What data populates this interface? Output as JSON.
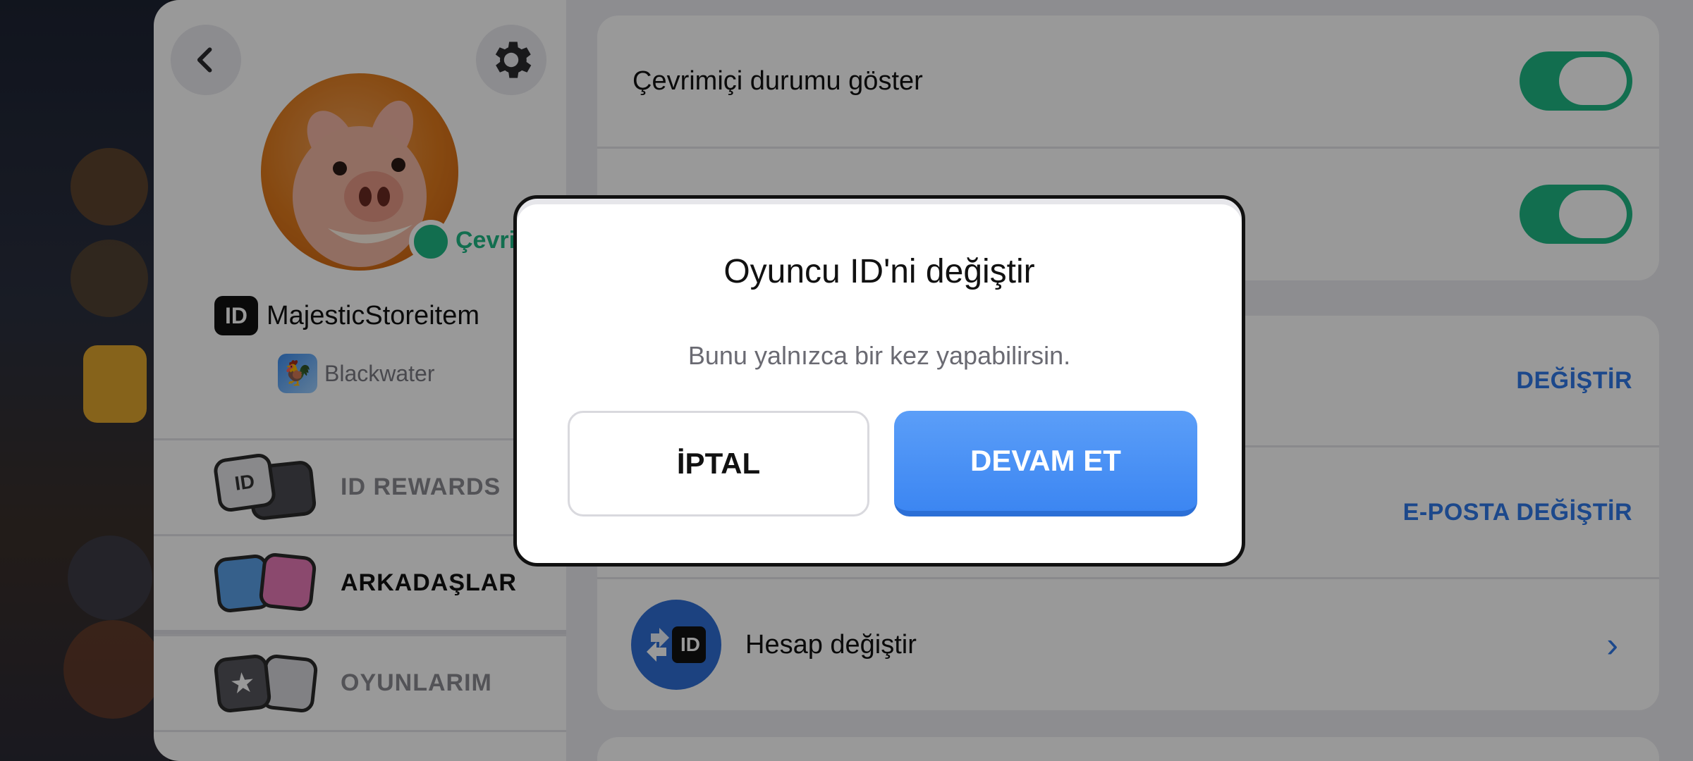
{
  "profile": {
    "status_text": "Çevrimiçi",
    "username": "MajesticStoreitem",
    "id_badge": "ID",
    "clan_name": "Blackwater",
    "menu": [
      {
        "label": "ID REWARDS",
        "color": "#8a8a92",
        "icon": "id-card-icon"
      },
      {
        "label": "ARKADAŞLAR",
        "color": "#111111",
        "icon": "friends-faces-icon"
      },
      {
        "label": "OYUNLARIM",
        "color": "#8a8a92",
        "icon": "games-star-sword-icon"
      }
    ]
  },
  "settings": {
    "rows": [
      {
        "label": "Çevrimiçi durumu göster",
        "control": "toggle",
        "on": true
      },
      {
        "label": "",
        "control": "toggle",
        "on": true
      },
      {
        "label": "",
        "action": "DEĞİŞTİR"
      },
      {
        "label": "",
        "action": "E-POSTA DEĞİŞTİR"
      },
      {
        "label": "Hesap değiştir",
        "control": "chevron"
      }
    ],
    "switch_account_icon_text": "ID"
  },
  "modal": {
    "title": "Oyuncu ID'ni değiştir",
    "subtitle": "Bunu yalnızca bir kez yapabilirsin.",
    "cancel_label": "İPTAL",
    "continue_label": "DEVAM ET"
  },
  "colors": {
    "accent_blue": "#3c86f2",
    "toggle_green": "#1fb884",
    "link_blue": "#2f78e8"
  }
}
